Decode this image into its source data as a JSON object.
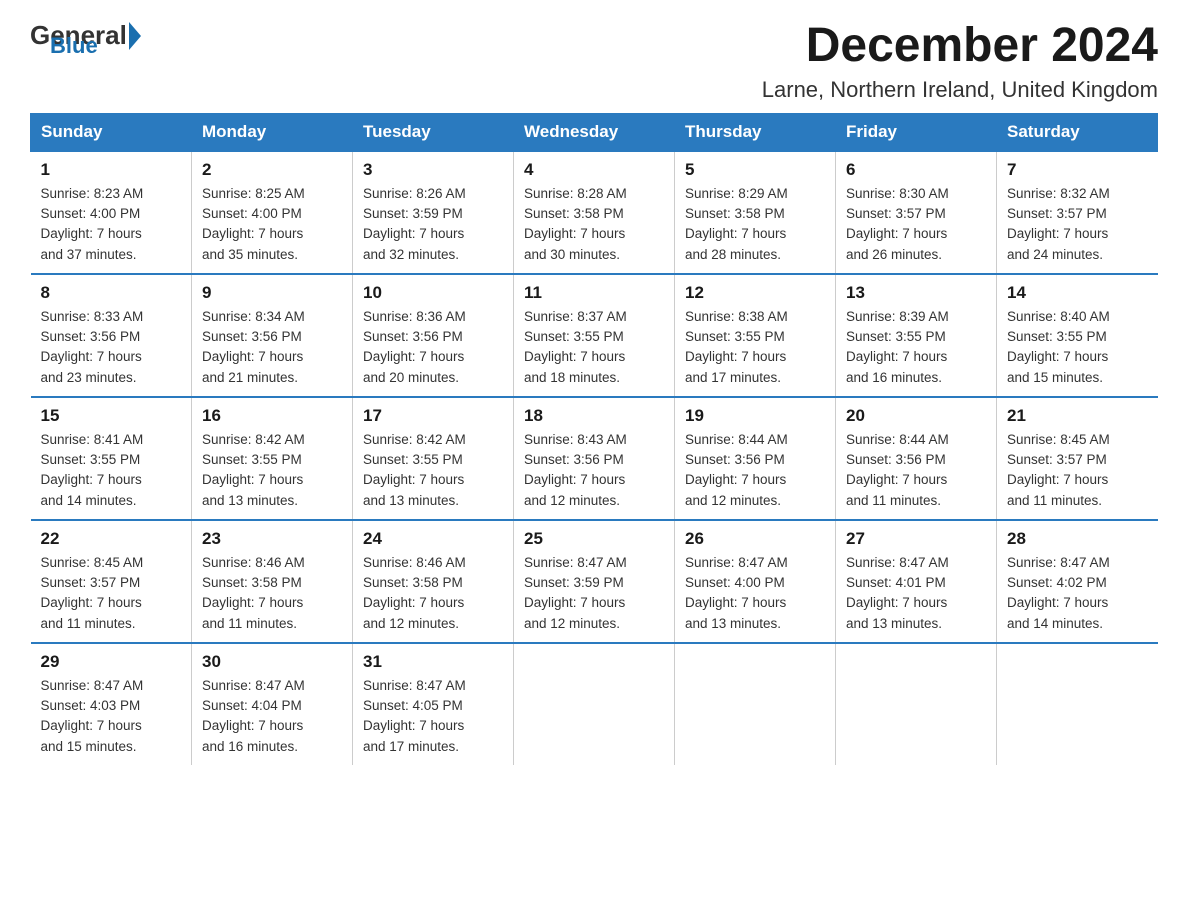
{
  "logo": {
    "general": "General",
    "blue": "Blue"
  },
  "title": "December 2024",
  "subtitle": "Larne, Northern Ireland, United Kingdom",
  "weekdays": [
    "Sunday",
    "Monday",
    "Tuesday",
    "Wednesday",
    "Thursday",
    "Friday",
    "Saturday"
  ],
  "weeks": [
    [
      {
        "day": "1",
        "sunrise": "8:23 AM",
        "sunset": "4:00 PM",
        "daylight": "7 hours and 37 minutes."
      },
      {
        "day": "2",
        "sunrise": "8:25 AM",
        "sunset": "4:00 PM",
        "daylight": "7 hours and 35 minutes."
      },
      {
        "day": "3",
        "sunrise": "8:26 AM",
        "sunset": "3:59 PM",
        "daylight": "7 hours and 32 minutes."
      },
      {
        "day": "4",
        "sunrise": "8:28 AM",
        "sunset": "3:58 PM",
        "daylight": "7 hours and 30 minutes."
      },
      {
        "day": "5",
        "sunrise": "8:29 AM",
        "sunset": "3:58 PM",
        "daylight": "7 hours and 28 minutes."
      },
      {
        "day": "6",
        "sunrise": "8:30 AM",
        "sunset": "3:57 PM",
        "daylight": "7 hours and 26 minutes."
      },
      {
        "day": "7",
        "sunrise": "8:32 AM",
        "sunset": "3:57 PM",
        "daylight": "7 hours and 24 minutes."
      }
    ],
    [
      {
        "day": "8",
        "sunrise": "8:33 AM",
        "sunset": "3:56 PM",
        "daylight": "7 hours and 23 minutes."
      },
      {
        "day": "9",
        "sunrise": "8:34 AM",
        "sunset": "3:56 PM",
        "daylight": "7 hours and 21 minutes."
      },
      {
        "day": "10",
        "sunrise": "8:36 AM",
        "sunset": "3:56 PM",
        "daylight": "7 hours and 20 minutes."
      },
      {
        "day": "11",
        "sunrise": "8:37 AM",
        "sunset": "3:55 PM",
        "daylight": "7 hours and 18 minutes."
      },
      {
        "day": "12",
        "sunrise": "8:38 AM",
        "sunset": "3:55 PM",
        "daylight": "7 hours and 17 minutes."
      },
      {
        "day": "13",
        "sunrise": "8:39 AM",
        "sunset": "3:55 PM",
        "daylight": "7 hours and 16 minutes."
      },
      {
        "day": "14",
        "sunrise": "8:40 AM",
        "sunset": "3:55 PM",
        "daylight": "7 hours and 15 minutes."
      }
    ],
    [
      {
        "day": "15",
        "sunrise": "8:41 AM",
        "sunset": "3:55 PM",
        "daylight": "7 hours and 14 minutes."
      },
      {
        "day": "16",
        "sunrise": "8:42 AM",
        "sunset": "3:55 PM",
        "daylight": "7 hours and 13 minutes."
      },
      {
        "day": "17",
        "sunrise": "8:42 AM",
        "sunset": "3:55 PM",
        "daylight": "7 hours and 13 minutes."
      },
      {
        "day": "18",
        "sunrise": "8:43 AM",
        "sunset": "3:56 PM",
        "daylight": "7 hours and 12 minutes."
      },
      {
        "day": "19",
        "sunrise": "8:44 AM",
        "sunset": "3:56 PM",
        "daylight": "7 hours and 12 minutes."
      },
      {
        "day": "20",
        "sunrise": "8:44 AM",
        "sunset": "3:56 PM",
        "daylight": "7 hours and 11 minutes."
      },
      {
        "day": "21",
        "sunrise": "8:45 AM",
        "sunset": "3:57 PM",
        "daylight": "7 hours and 11 minutes."
      }
    ],
    [
      {
        "day": "22",
        "sunrise": "8:45 AM",
        "sunset": "3:57 PM",
        "daylight": "7 hours and 11 minutes."
      },
      {
        "day": "23",
        "sunrise": "8:46 AM",
        "sunset": "3:58 PM",
        "daylight": "7 hours and 11 minutes."
      },
      {
        "day": "24",
        "sunrise": "8:46 AM",
        "sunset": "3:58 PM",
        "daylight": "7 hours and 12 minutes."
      },
      {
        "day": "25",
        "sunrise": "8:47 AM",
        "sunset": "3:59 PM",
        "daylight": "7 hours and 12 minutes."
      },
      {
        "day": "26",
        "sunrise": "8:47 AM",
        "sunset": "4:00 PM",
        "daylight": "7 hours and 13 minutes."
      },
      {
        "day": "27",
        "sunrise": "8:47 AM",
        "sunset": "4:01 PM",
        "daylight": "7 hours and 13 minutes."
      },
      {
        "day": "28",
        "sunrise": "8:47 AM",
        "sunset": "4:02 PM",
        "daylight": "7 hours and 14 minutes."
      }
    ],
    [
      {
        "day": "29",
        "sunrise": "8:47 AM",
        "sunset": "4:03 PM",
        "daylight": "7 hours and 15 minutes."
      },
      {
        "day": "30",
        "sunrise": "8:47 AM",
        "sunset": "4:04 PM",
        "daylight": "7 hours and 16 minutes."
      },
      {
        "day": "31",
        "sunrise": "8:47 AM",
        "sunset": "4:05 PM",
        "daylight": "7 hours and 17 minutes."
      },
      null,
      null,
      null,
      null
    ]
  ],
  "labels": {
    "sunrise": "Sunrise:",
    "sunset": "Sunset:",
    "daylight": "Daylight:"
  }
}
